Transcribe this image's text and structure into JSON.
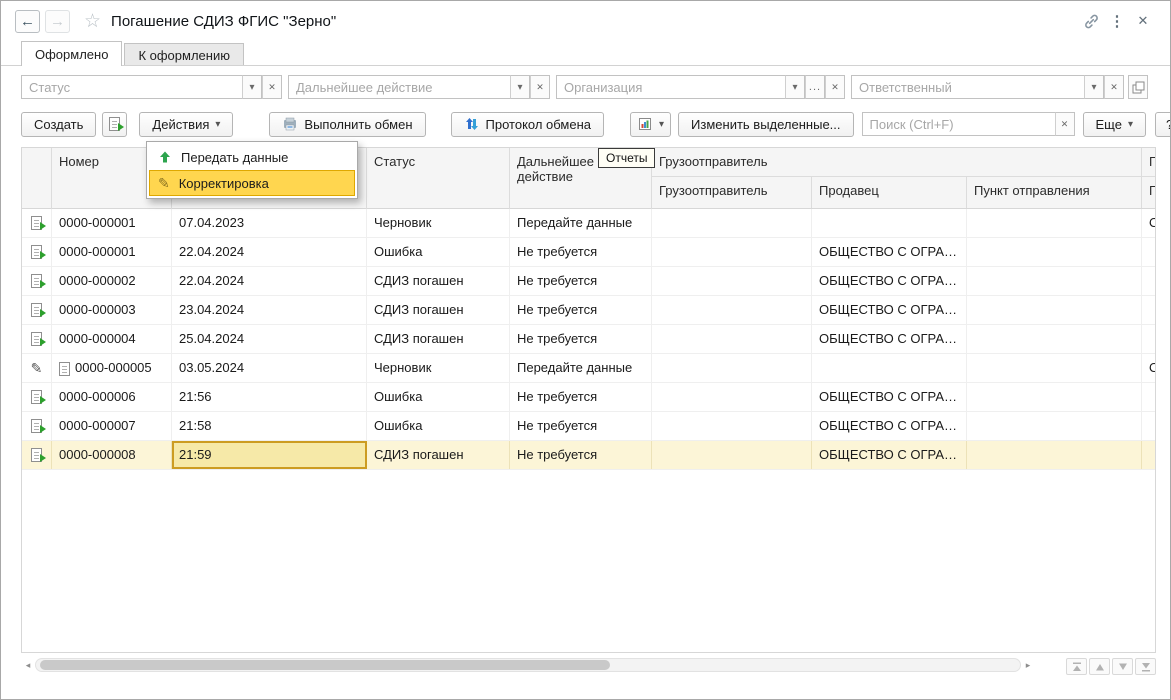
{
  "titlebar": {
    "title": "Погашение СДИЗ ФГИС \"Зерно\""
  },
  "icons": {
    "back": "←",
    "forward": "→",
    "favorite": "☆",
    "kebab": "⋮",
    "close": "✕",
    "caret": "▾",
    "clear": "✕",
    "ellipsis": "...",
    "pencil": "✎",
    "scroll_left": "◂",
    "scroll_right": "▸"
  },
  "tabs": [
    {
      "label": "Оформлено"
    },
    {
      "label": "К оформлению"
    }
  ],
  "filters": [
    {
      "placeholder": "Статус"
    },
    {
      "placeholder": "Дальнейшее действие"
    },
    {
      "placeholder": "Организация"
    },
    {
      "placeholder": "Ответственный"
    }
  ],
  "toolbar": {
    "create": "Создать",
    "actions": "Действия",
    "run_exchange": "Выполнить обмен",
    "exchange_protocol": "Протокол обмена",
    "edit_selected": "Изменить выделенные...",
    "search_placeholder": "Поиск (Ctrl+F)",
    "more": "Еще",
    "help": "?",
    "reports_tooltip": "Отчеты"
  },
  "actions_menu": {
    "items": [
      {
        "label": "Передать данные"
      },
      {
        "label": "Корректировка"
      }
    ]
  },
  "table": {
    "headers": {
      "number": "Номер",
      "date": "",
      "status": "Статус",
      "action": "Дальнейшее действие",
      "shipper_group": "Грузоотправитель",
      "shipper": "Грузоотправитель",
      "seller": "Продавец",
      "departure": "Пункт отправления",
      "consignee_group": "Гр",
      "consignee": "Гр"
    },
    "rows": [
      {
        "number": "0000-000001",
        "date": "07.04.2023",
        "status": "Черновик",
        "action": "Передайте данные",
        "seller": "",
        "last": "ОБ"
      },
      {
        "number": "0000-000001",
        "date": "22.04.2024",
        "status": "Ошибка",
        "action": "Не требуется",
        "seller": "ОБЩЕСТВО С ОГРА…",
        "last": ""
      },
      {
        "number": "0000-000002",
        "date": "22.04.2024",
        "status": "СДИЗ погашен",
        "action": "Не требуется",
        "seller": "ОБЩЕСТВО С ОГРА…",
        "last": ""
      },
      {
        "number": "0000-000003",
        "date": "23.04.2024",
        "status": "СДИЗ погашен",
        "action": "Не требуется",
        "seller": "ОБЩЕСТВО С ОГРА…",
        "last": ""
      },
      {
        "number": "0000-000004",
        "date": "25.04.2024",
        "status": "СДИЗ погашен",
        "action": "Не требуется",
        "seller": "ОБЩЕСТВО С ОГРА…",
        "last": ""
      },
      {
        "number": "0000-000005",
        "date": "03.05.2024",
        "status": "Черновик",
        "action": "Передайте данные",
        "seller": "",
        "last": "ОБ"
      },
      {
        "number": "0000-000006",
        "date": "21:56",
        "status": "Ошибка",
        "action": "Не требуется",
        "seller": "ОБЩЕСТВО С ОГРА…",
        "last": ""
      },
      {
        "number": "0000-000007",
        "date": "21:58",
        "status": "Ошибка",
        "action": "Не требуется",
        "seller": "ОБЩЕСТВО С ОГРА…",
        "last": ""
      },
      {
        "number": "0000-000008",
        "date": "21:59",
        "status": "СДИЗ погашен",
        "action": "Не требуется",
        "seller": "ОБЩЕСТВО С ОГРА…",
        "last": ""
      }
    ]
  }
}
